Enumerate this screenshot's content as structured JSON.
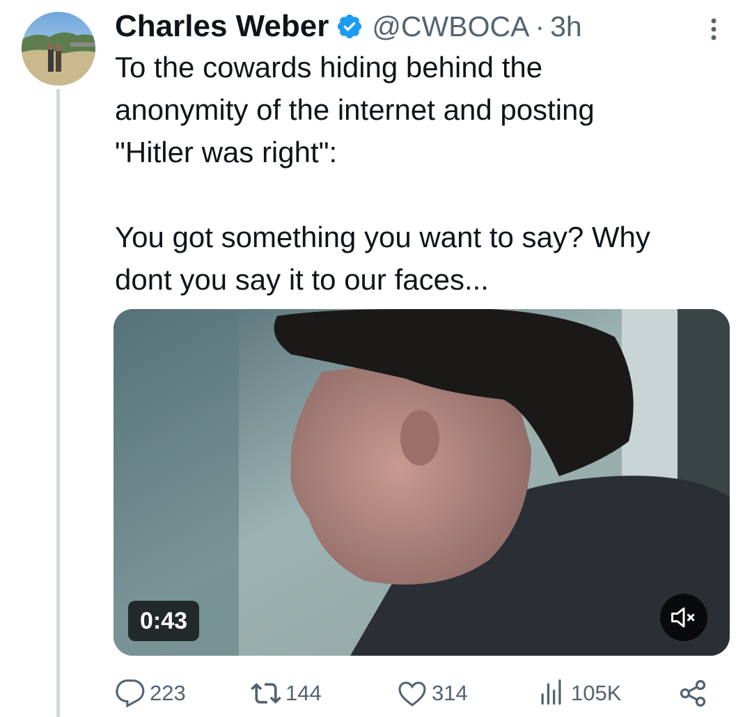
{
  "tweet": {
    "author_name": "Charles Weber",
    "handle": "@CWBOCA",
    "separator": "·",
    "time": "3h",
    "verified": true,
    "text_lines": [
      "To the cowards hiding behind the",
      "anonymity of the internet and posting",
      "\"Hitler was right\":",
      "You got something you want to say? Why",
      "dont you say it to our faces..."
    ]
  },
  "media": {
    "type": "video",
    "duration": "0:43",
    "muted": true
  },
  "actions": {
    "replies": "223",
    "retweets": "144",
    "likes": "314",
    "views": "105K"
  },
  "colors": {
    "text": "#0f1419",
    "secondary": "#536471",
    "verified": "#1d9bf0",
    "thread_line": "#cfd9de"
  },
  "icons": [
    "more-icon",
    "verified-badge-icon",
    "reply-icon",
    "retweet-icon",
    "like-icon",
    "views-icon",
    "share-icon",
    "mute-icon"
  ]
}
